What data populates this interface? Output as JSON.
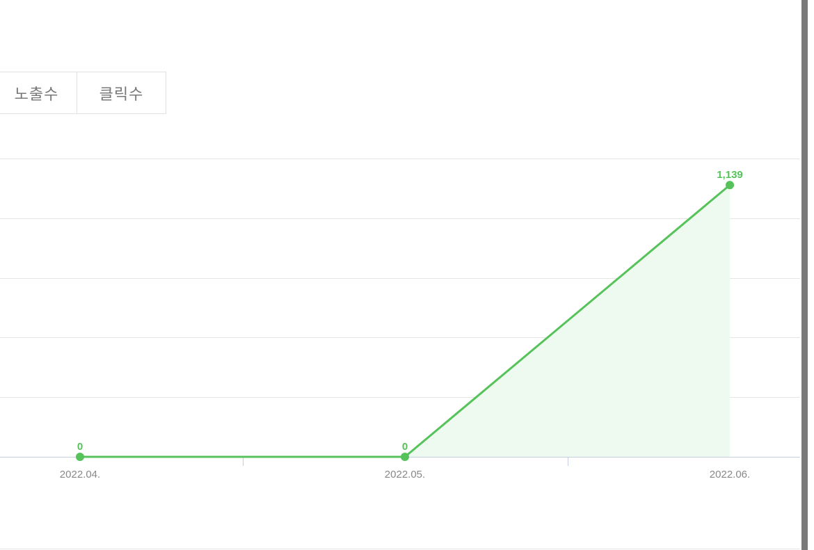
{
  "tabs": {
    "impressions_label": "노출수",
    "clicks_label": "클릭수"
  },
  "colors": {
    "line": "#55c35a",
    "area": "#eef9ef",
    "grid": "#e5e5e5",
    "axis": "#c7cde0",
    "tick_label": "#888888"
  },
  "chart_data": {
    "type": "area",
    "categories": [
      "2022.04.",
      "2022.05.",
      "2022.06."
    ],
    "series": [
      {
        "values": [
          0,
          0,
          1139
        ],
        "data_labels": [
          "0",
          "0",
          "1,139"
        ]
      }
    ],
    "ylim": [
      0,
      1250
    ],
    "grid": true
  }
}
